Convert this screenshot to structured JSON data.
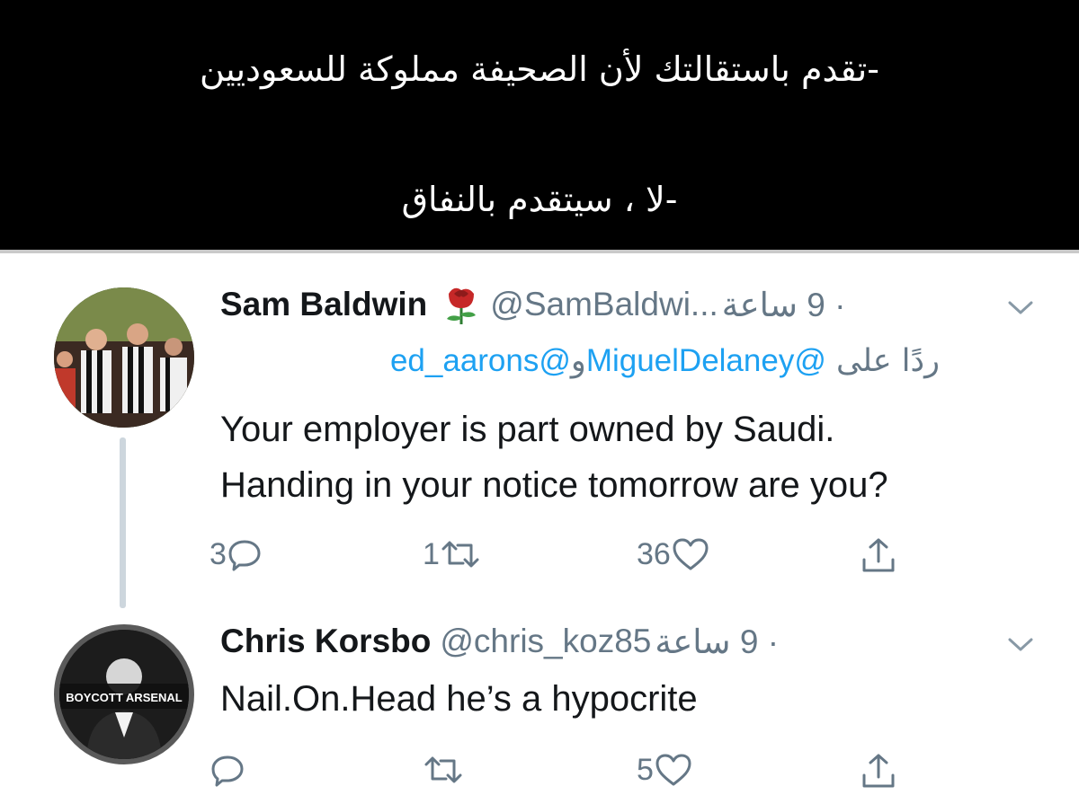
{
  "caption": {
    "line1": "-تقدم باستقالتك لأن الصحيفة مملوكة للسعوديين",
    "line2": "-لا ، سيتقدم بالنفاق"
  },
  "tweets": [
    {
      "name": "Sam Baldwin",
      "name_emoji": "rose-icon",
      "handle": "@SamBaldwi...",
      "time": "· 9 ساعة",
      "reply_prefix": "ردًا على",
      "mention1": "@MiguelDelaney",
      "reply_joiner": "و",
      "mention2": "@ed_aarons",
      "text_line1": "Your employer is part owned by Saudi.",
      "text_line2": "Handing in your notice tomorrow are you?",
      "replies": "3",
      "retweets": "1",
      "likes": "36"
    },
    {
      "name": "Chris Korsbo",
      "handle": "@chris_koz85",
      "time": "· 9 ساعة",
      "avatar_text": "BOYCOTT ARSENAL",
      "text_line1": "Nail.On.Head he’s a hypocrite",
      "replies": "",
      "retweets": "",
      "likes": "5"
    }
  ],
  "icons": [
    "chevron-down-icon",
    "reply-icon",
    "retweet-icon",
    "like-icon",
    "share-icon"
  ],
  "colors": {
    "link": "#1da1f2",
    "secondary": "#657786",
    "thread": "#cdd6dd"
  }
}
